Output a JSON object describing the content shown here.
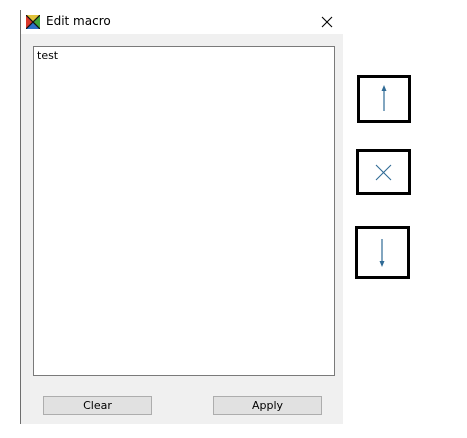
{
  "window": {
    "title": "Edit macro",
    "app_icon": "app-icon",
    "close_icon": "close-icon"
  },
  "editor": {
    "value": "test"
  },
  "buttons": {
    "clear_label": "Clear",
    "apply_label": "Apply"
  },
  "side_controls": {
    "move_up_icon": "arrow-up-icon",
    "delete_icon": "x-icon",
    "move_down_icon": "arrow-down-icon",
    "icon_color": "#2f6a95"
  }
}
